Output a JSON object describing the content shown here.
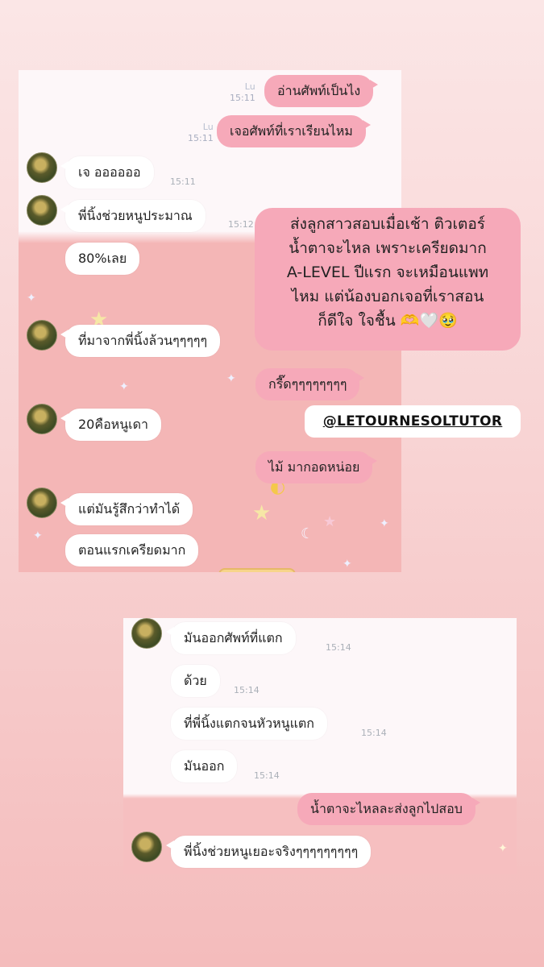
{
  "colors": {
    "incoming_bubble": "#ffffff",
    "outgoing_bubble": "#f6a9b9",
    "chat_bg_pink": "#f4b6b6",
    "timestamp": "#aab0b8"
  },
  "screenshot1": {
    "messages": [
      {
        "side": "out",
        "text": "อ่านศัพท์เป็นไง",
        "read": "Lu",
        "time": "15:11"
      },
      {
        "side": "out",
        "text": "เจอศัพท์ที่เราเรียนไหม",
        "read": "Lu",
        "time": "15:11"
      },
      {
        "side": "in",
        "text": "เจ ออออออ",
        "time": "15:11"
      },
      {
        "side": "in",
        "text": "พี่นิ้งช่วยหนูประมาณ",
        "time": "15:12"
      },
      {
        "side": "in",
        "text": "80%เลย"
      },
      {
        "side": "in",
        "text": "ที่มาจากพี่นิ้งล้วนๆๆๆๆๆ"
      },
      {
        "side": "out",
        "text": "กรี๊ดๆๆๆๆๆๆๆๆ"
      },
      {
        "side": "in",
        "text": "20คือหนูเดา"
      },
      {
        "side": "out",
        "text": "ไม้ มากอดหน่อย"
      },
      {
        "side": "in",
        "text": "แต่มันรู้สึกว่าทำได้"
      },
      {
        "side": "in",
        "text": "ตอนแรกเครียดมาก"
      }
    ]
  },
  "screenshot2": {
    "messages": [
      {
        "side": "in",
        "text": "มันออกศัพท์ที่แตก",
        "time": "15:14"
      },
      {
        "side": "in",
        "text": "ด้วย",
        "time": "15:14"
      },
      {
        "side": "in",
        "text": "ที่พี่นิ้งแตกจนหัวหนูแตก",
        "time": "15:14"
      },
      {
        "side": "in",
        "text": "มันออก",
        "time": "15:14"
      },
      {
        "side": "out",
        "text": "น้ำตาจะไหลละส่งลูกไปสอบ"
      },
      {
        "side": "in",
        "text": "พี่นิ้งช่วยหนูเยอะจริงๆๆๆๆๆๆๆๆๆ"
      }
    ]
  },
  "caption": {
    "lines": [
      "ส่งลูกสาวสอบเมื่อเช้า ติวเตอร์",
      "น้ำตาจะไหล เพราะเครียดมาก",
      "A-LEVEL ปีแรก จะเหมือนแพท",
      "ไหม แต่น้องบอกเจอที่เราสอน",
      "ก็ดีใจ ใจชื้น 🫶🤍🥹"
    ]
  },
  "mention": "@LETOURNESOLTUTOR"
}
